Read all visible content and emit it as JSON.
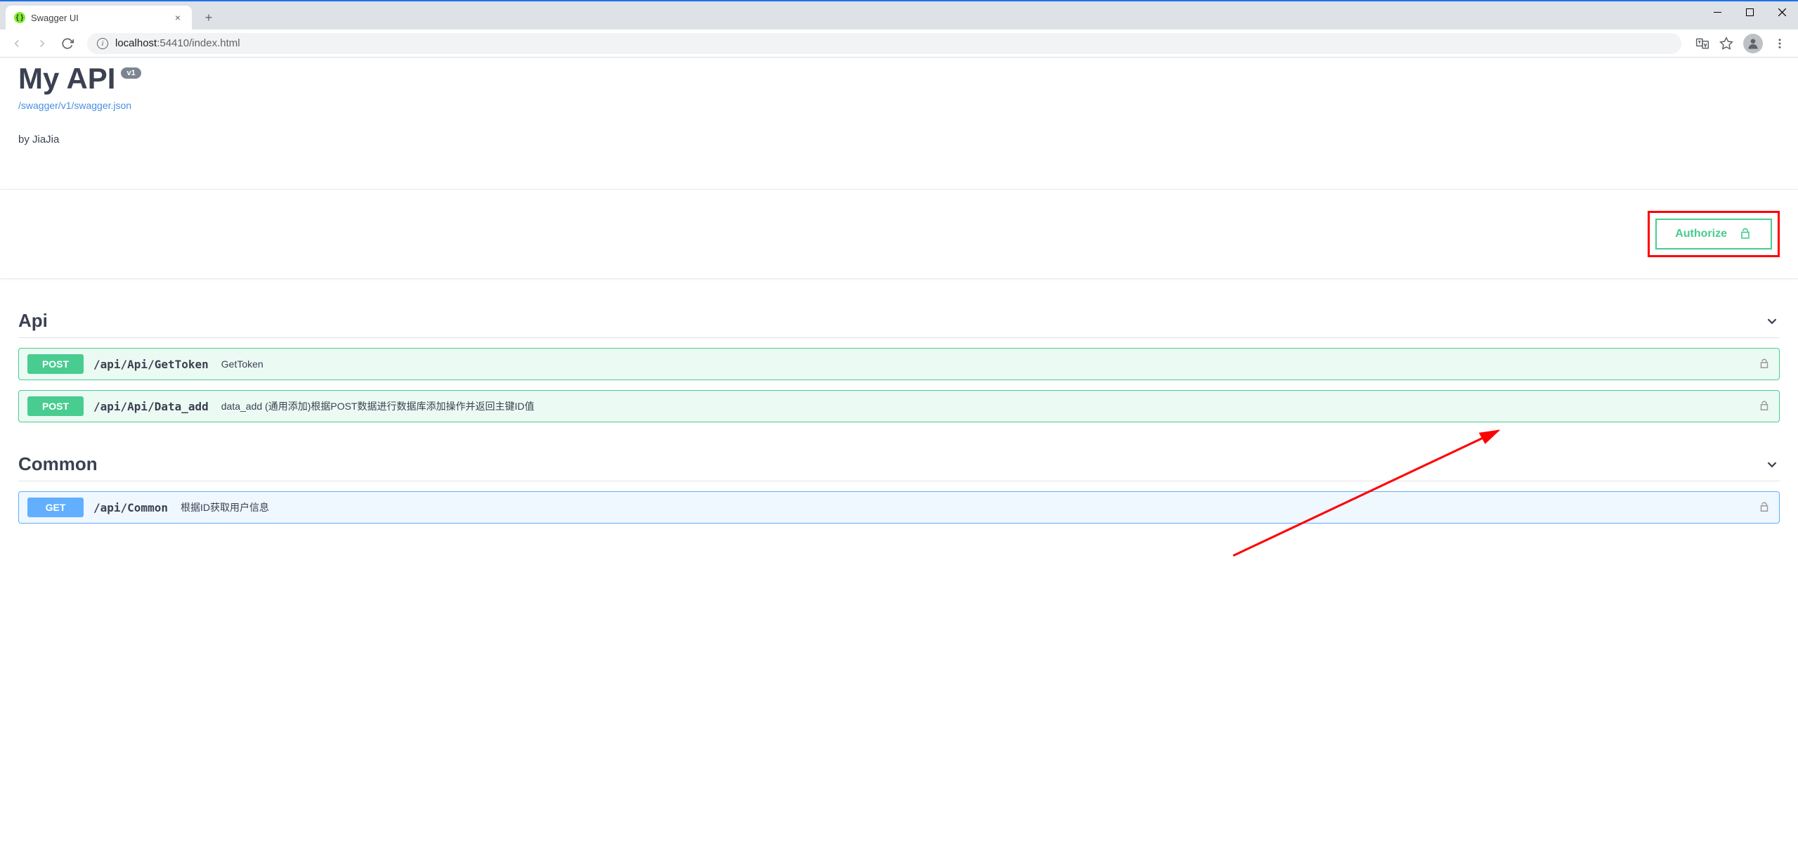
{
  "browser": {
    "tab_title": "Swagger UI",
    "url_host": "localhost",
    "url_port": ":54410",
    "url_path": "/index.html"
  },
  "api": {
    "title": "My API",
    "version": "v1",
    "spec_link": "/swagger/v1/swagger.json",
    "author": "by JiaJia"
  },
  "authorize_label": "Authorize",
  "tags": [
    {
      "name": "Api",
      "ops": [
        {
          "method": "POST",
          "path": "/api/Api/GetToken",
          "summary": "GetToken"
        },
        {
          "method": "POST",
          "path": "/api/Api/Data_add",
          "summary": "data_add (通用添加)根据POST数据进行数据库添加操作并返回主键ID值"
        }
      ]
    },
    {
      "name": "Common",
      "ops": [
        {
          "method": "GET",
          "path": "/api/Common",
          "summary": "根据ID获取用户信息"
        }
      ]
    }
  ]
}
